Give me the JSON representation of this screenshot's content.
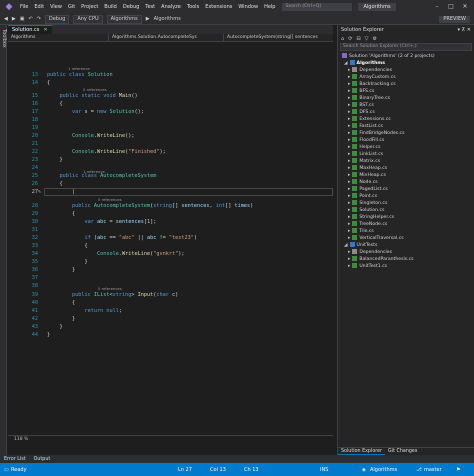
{
  "menu": [
    "File",
    "Edit",
    "View",
    "Git",
    "Project",
    "Build",
    "Debug",
    "Test",
    "Analyze",
    "Tools",
    "Extensions",
    "Window",
    "Help"
  ],
  "search_placeholder": "Search (Ctrl+Q)",
  "project_name": "Algorithms",
  "toolbar": {
    "config": "Debug",
    "platform": "Any CPU",
    "startup": "Algorithms",
    "run_label": "Algorithms"
  },
  "preview_label": "PREVIEW",
  "side_tool_label": "Toolbox",
  "editor": {
    "tab_label": "Solution.cs",
    "nav_project": "Algorithms",
    "nav_class": "Algorithms.Solution.AutocompleteSys",
    "nav_member": "AutocompleteSystem(string[] sentences",
    "zoom": "118 %",
    "references": {
      "r1": "1 reference",
      "r2": "0 references",
      "r3": "1 reference",
      "r4": "0 references",
      "r5": "1 reference",
      "r6": "0 references"
    }
  },
  "solution_explorer": {
    "title": "Solution Explorer",
    "search_placeholder": "Search Solution Explorer (Ctrl+;)",
    "solution": "Solution 'Algorithms' (2 of 2 projects)",
    "project1": "Algorithms",
    "files": [
      "Dependencies",
      "ArrayCustom.cs",
      "Backtracking.cs",
      "BFS.cs",
      "BinaryTree.cs",
      "BST.cs",
      "DFS.cs",
      "Extensions.cs",
      "FastList.cs",
      "FindBridgeNodes.cs",
      "FloodFill.cs",
      "Helper.cs",
      "LinkList.cs",
      "Matrix.cs",
      "MaxHeap.cs",
      "MinHeap.cs",
      "Node.cs",
      "PagedList.cs",
      "Point.cs",
      "Singleton.cs",
      "Solution.cs",
      "StringHelper.cs",
      "TreeNode.cs",
      "Trie.cs",
      "VerticalTraversal.cs"
    ],
    "project2": "UnitTests",
    "files2": [
      "Dependencies",
      "BalancedParanthesis.cs",
      "UnitTest1.cs"
    ],
    "tab1": "Solution Explorer",
    "tab2": "Git Changes"
  },
  "bottom_tabs": [
    "Error List",
    "Output"
  ],
  "status": {
    "ready": "Ready",
    "ln": "Ln 27",
    "col": "Col 13",
    "ch": "Ch 13",
    "ins": "INS",
    "repo": "Algorithms",
    "branch": "master"
  }
}
